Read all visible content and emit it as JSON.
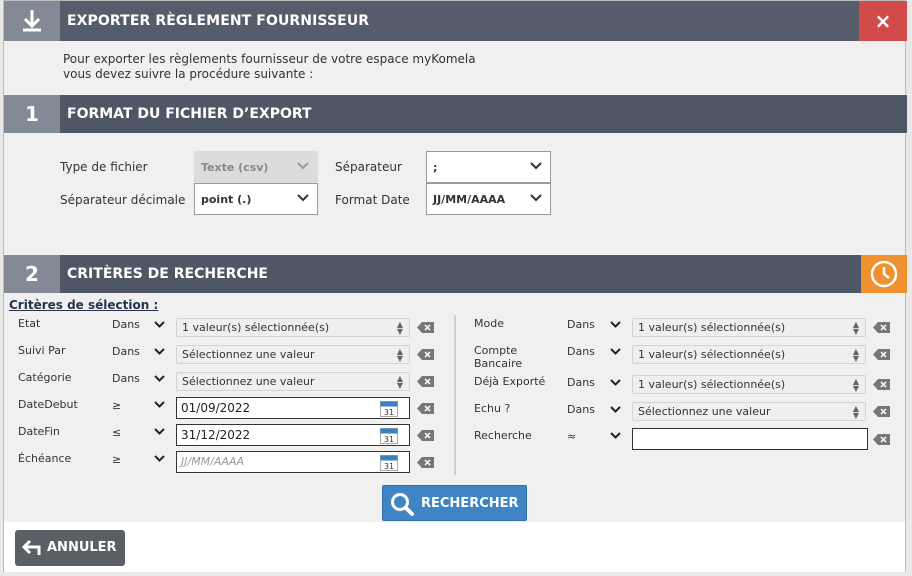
{
  "dialog": {
    "title": "EXPORTER RÈGLEMENT FOURNISSEUR",
    "close_icon": "×",
    "intro_line1": "Pour exporter les règlements fournisseur de votre espace myKomela",
    "intro_line2": "vous devez suivre la procédure suivante :"
  },
  "section1": {
    "number": "1",
    "title": "FORMAT DU FICHIER D’EXPORT",
    "type_label": "Type de fichier",
    "type_value": "Texte (csv)",
    "separator_label": "Séparateur",
    "separator_value": ";",
    "decimal_label": "Séparateur décimale",
    "decimal_value": "point (.)",
    "date_label": "Format Date",
    "date_value": "JJ/MM/AAAA"
  },
  "section2": {
    "number": "2",
    "title": "CRITÈRES DE RECHERCHE",
    "criteria_title": "Critères de sélection :",
    "left": [
      {
        "label": "Etat",
        "op": "Dans",
        "value": "1 valeur(s) sélectionnée(s)"
      },
      {
        "label": "Suivi Par",
        "op": "Dans",
        "value": "Sélectionnez une valeur"
      },
      {
        "label": "Catégorie",
        "op": "Dans",
        "value": "Sélectionnez une valeur"
      },
      {
        "label": "DateDebut",
        "op": "≥",
        "value": "01/09/2022"
      },
      {
        "label": "DateFin",
        "op": "≤",
        "value": "31/12/2022"
      },
      {
        "label": "Échéance",
        "op": "≥",
        "placeholder": "JJ/MM/AAAA"
      }
    ],
    "right": [
      {
        "label": "Mode",
        "op": "Dans",
        "value": "1 valeur(s) sélectionnée(s)"
      },
      {
        "label_line1": "Compte",
        "label_line2": "Bancaire",
        "op": "Dans",
        "value": "1 valeur(s) sélectionnée(s)"
      },
      {
        "label": "Déjà Exporté",
        "op": "Dans",
        "value": "1 valeur(s) sélectionnée(s)"
      },
      {
        "label": "Echu ?",
        "op": "Dans",
        "value": "Sélectionnez une valeur"
      },
      {
        "label": "Recherche",
        "op": "≈",
        "value": ""
      }
    ],
    "calendar_day": "31"
  },
  "actions": {
    "search_label": "RECHERCHER",
    "cancel_label": "ANNULER"
  },
  "colors": {
    "header": "#555d6c",
    "close": "#d24b4b",
    "clock": "#f0902e",
    "search_button": "#3f85c6",
    "cancel_button": "#5a5f66"
  }
}
